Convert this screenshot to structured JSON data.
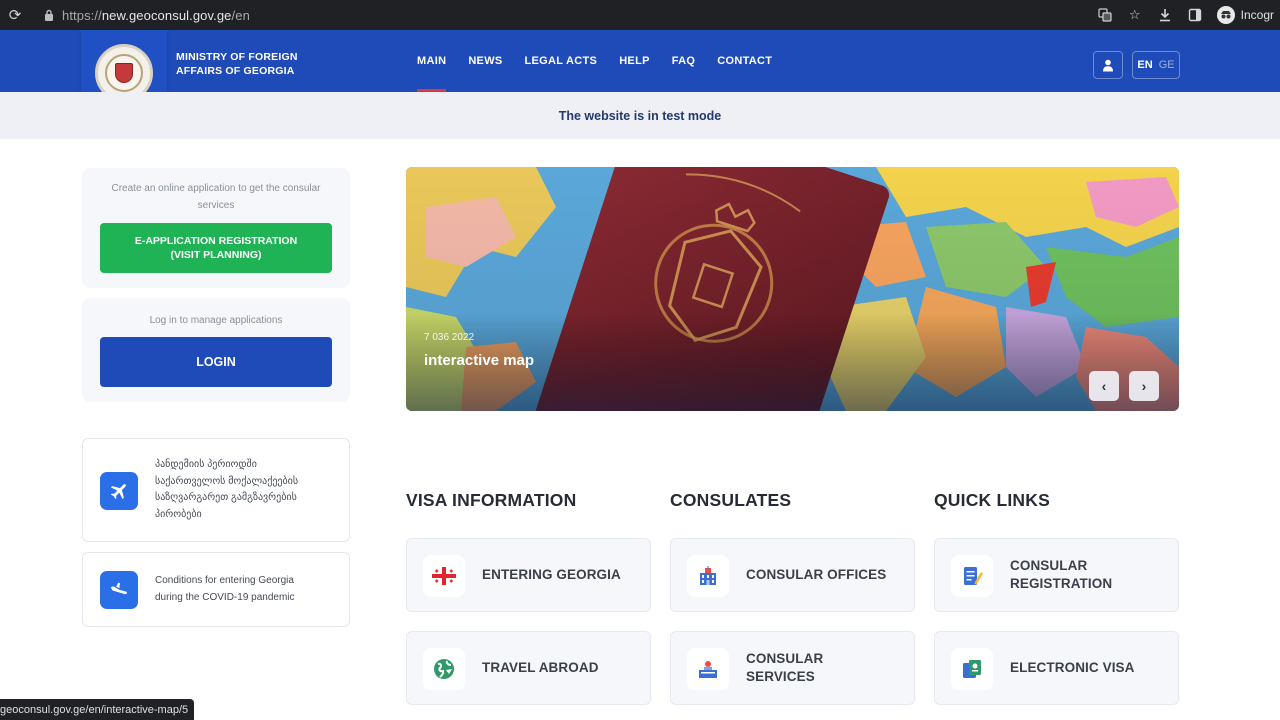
{
  "browser": {
    "url_scheme": "https://",
    "url_host": "new.geoconsul.gov.ge",
    "url_path": "/en",
    "incognito_label": "Incogr"
  },
  "header": {
    "ministry_line1": "MINISTRY OF FOREIGN",
    "ministry_line2": "AFFAIRS OF GEORGIA",
    "nav": [
      {
        "label": "MAIN",
        "active": true
      },
      {
        "label": "NEWS",
        "active": false
      },
      {
        "label": "LEGAL ACTS",
        "active": false
      },
      {
        "label": "HELP",
        "active": false
      },
      {
        "label": "FAQ",
        "active": false
      },
      {
        "label": "CONTACT",
        "active": false
      }
    ],
    "lang_en": "EN",
    "lang_ge": "GE"
  },
  "notice": "The website is in test mode",
  "sidebar": {
    "apply_text_line1": "Create an online application to get the consular",
    "apply_text_line2": "services",
    "apply_button_line1": "E-APPLICATION REGISTRATION",
    "apply_button_line2": "(VISIT PLANNING)",
    "login_text": "Log in to manage applications",
    "login_button": "LOGIN",
    "info_cards": [
      {
        "lines": [
          "პანდემიის პერიოდში",
          "საქართველოს მოქალაქეების",
          "საზღვარგარეთ გამგზავრების",
          "პირობები"
        ],
        "icon": "airplane-icon"
      },
      {
        "lines": [
          "Conditions for entering Georgia",
          "during the COVID-19 pandemic"
        ],
        "icon": "plane-landing-icon"
      }
    ]
  },
  "hero": {
    "date": "7 036 2022",
    "title": "interactive map",
    "prev": "‹",
    "next": "›"
  },
  "sections": [
    {
      "title": "VISA INFORMATION",
      "tiles": [
        {
          "label": [
            "ENTERING GEORGIA"
          ],
          "icon": "georgia-flag-icon"
        },
        {
          "label": [
            "TRAVEL ABROAD"
          ],
          "icon": "globe-icon"
        }
      ]
    },
    {
      "title": "CONSULATES",
      "tiles": [
        {
          "label": [
            "CONSULAR OFFICES"
          ],
          "icon": "building-icon"
        },
        {
          "label": [
            "CONSULAR",
            "SERVICES"
          ],
          "icon": "service-desk-icon"
        }
      ]
    },
    {
      "title": "QUICK LINKS",
      "tiles": [
        {
          "label": [
            "CONSULAR",
            "REGISTRATION"
          ],
          "icon": "document-edit-icon"
        },
        {
          "label": [
            "ELECTRONIC VISA"
          ],
          "icon": "e-visa-icon"
        }
      ]
    }
  ],
  "status_url": "geoconsul.gov.ge/en/interactive-map/5",
  "colors": {
    "brand_blue": "#1e4bb8",
    "green": "#1fb355",
    "accent_red": "#e4353a"
  }
}
